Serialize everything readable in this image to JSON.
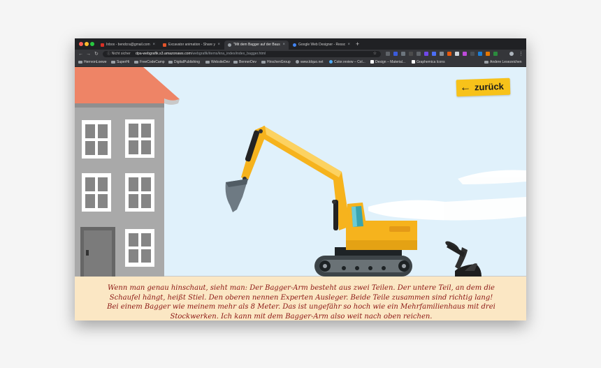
{
  "browser": {
    "tabs": [
      {
        "title": "Inbox - bendcra@gmail.com - ",
        "favicon_color": "#d93025",
        "active": false
      },
      {
        "title": "Excavator animation - Share y",
        "favicon_color": "#e2542b",
        "active": false
      },
      {
        "title": "\"Mit dem Bagger auf der Bausi",
        "favicon_color": "#9aa0a6",
        "active": true
      },
      {
        "title": "Google Web Designer - Resso",
        "favicon_color": "#4285f4",
        "active": false
      }
    ],
    "tab_close": "×",
    "new_tab": "+",
    "nav": {
      "back": "←",
      "forward": "→",
      "reload": "↻"
    },
    "security_label": "ⓘ Nicht sicher",
    "url_domain": "dpa-webgrafik.s3.amazonaws.com",
    "url_path": "/webgrafik/items/kna_index/index_bagger.html",
    "star": "☆",
    "bookmarks": [
      "HerrvonLoewe",
      "SuperHi",
      "FreeCodeCamp",
      "DigitalPublishing",
      "WebsiteDev",
      "BennerDev",
      "HirschenGroup",
      "www.ldquo.net",
      "Color.review – Col...",
      "Design – Material...",
      "Graphemica Icons"
    ],
    "other_bookmarks": "Andere Lesezeichen"
  },
  "page": {
    "back_button": {
      "arrow": "🡐",
      "label": "zurück"
    },
    "story_text": "Wenn man genau hinschaut, sieht man: Der Bagger-Arm besteht aus zwei Teilen. Der untere Teil, an dem die Schaufel hängt, heißt Stiel. Den oberen nennen Experten Ausleger. Beide Teile zusammen sind richtig lang! Bei einem Bagger wie meinem mehr als 8 Meter. Das ist ungefähr so hoch wie ein Mehrfamilienhaus mit drei Stockwerken. Ich kann mit dem Bagger-Arm also weit nach oben reichen."
  },
  "colors": {
    "sky": "#e0f1fb",
    "excavator_yellow": "#f6b31d",
    "roof": "#ee8466",
    "building": "#a9a9a9",
    "text_panel": "#fbe7c4",
    "text": "#8a1512"
  }
}
